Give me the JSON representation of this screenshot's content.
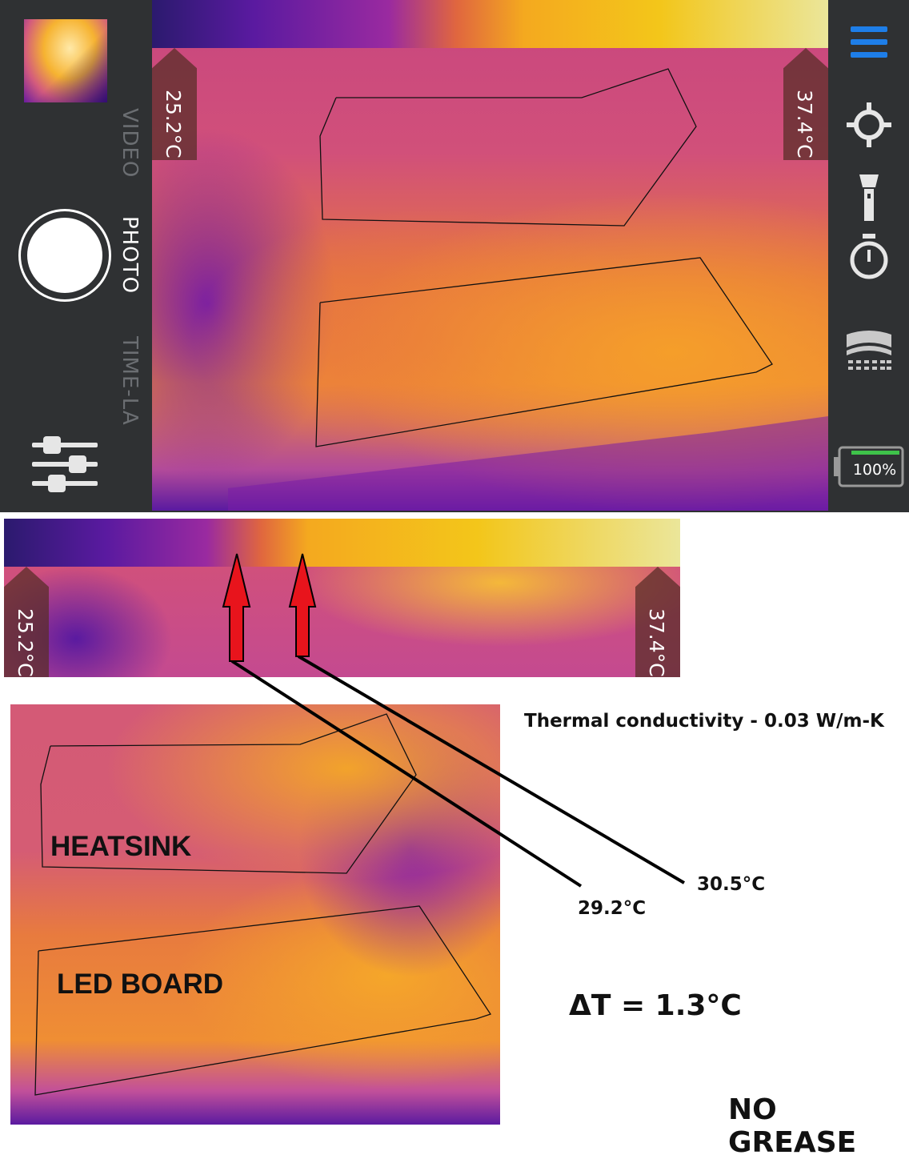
{
  "app": {
    "modes": {
      "video": "VIDEO",
      "photo": "PHOTO",
      "timelapse": "TIME-LA"
    },
    "temp_min": "25.2°C",
    "temp_max": "37.4°C",
    "battery_percent": "100%",
    "battery_level": 1.0,
    "icons": [
      "menu-icon",
      "crosshair-icon",
      "flashlight-icon",
      "timer-icon",
      "palette-icon",
      "settings-sliders-icon"
    ],
    "accent_color": "#1e7ee8",
    "battery_color": "#3ec24a"
  },
  "crop": {
    "temp_min": "25.2°C",
    "temp_max": "37.4°C"
  },
  "annotations": {
    "conductivity": "Thermal conductivity - 0.03 W/m-K",
    "heatsink_label": "HEATSINK",
    "ledboard_label": "LED BOARD",
    "reading_left": "29.2°C",
    "reading_right": "30.5°C",
    "delta_t": "ΔT = 1.3°C",
    "condition": "NO GREASE",
    "arrow_color": "#e8141c"
  }
}
